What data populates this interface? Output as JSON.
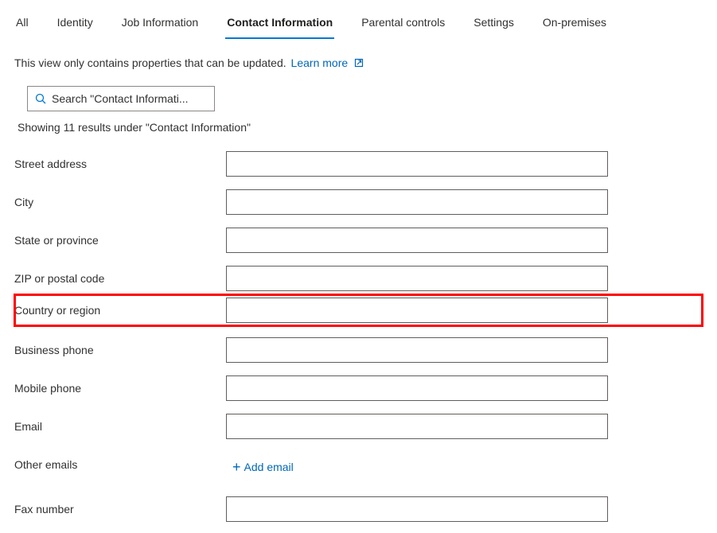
{
  "tabs": {
    "all": "All",
    "identity": "Identity",
    "job": "Job Information",
    "contact": "Contact Information",
    "parental": "Parental controls",
    "settings": "Settings",
    "onprem": "On-premises"
  },
  "info": {
    "text": "This view only contains properties that can be updated.",
    "learn_more": "Learn more"
  },
  "search": {
    "placeholder": "Search \"Contact Informati..."
  },
  "results_text": "Showing 11 results under \"Contact Information\"",
  "fields": {
    "street": {
      "label": "Street address",
      "value": ""
    },
    "city": {
      "label": "City",
      "value": ""
    },
    "state": {
      "label": "State or province",
      "value": ""
    },
    "zip": {
      "label": "ZIP or postal code",
      "value": ""
    },
    "country": {
      "label": "Country or region",
      "value": ""
    },
    "businessphone": {
      "label": "Business phone",
      "value": ""
    },
    "mobilephone": {
      "label": "Mobile phone",
      "value": ""
    },
    "email": {
      "label": "Email",
      "value": ""
    },
    "otheremails": {
      "label": "Other emails"
    },
    "fax": {
      "label": "Fax number",
      "value": ""
    }
  },
  "add_email_label": "Add email"
}
